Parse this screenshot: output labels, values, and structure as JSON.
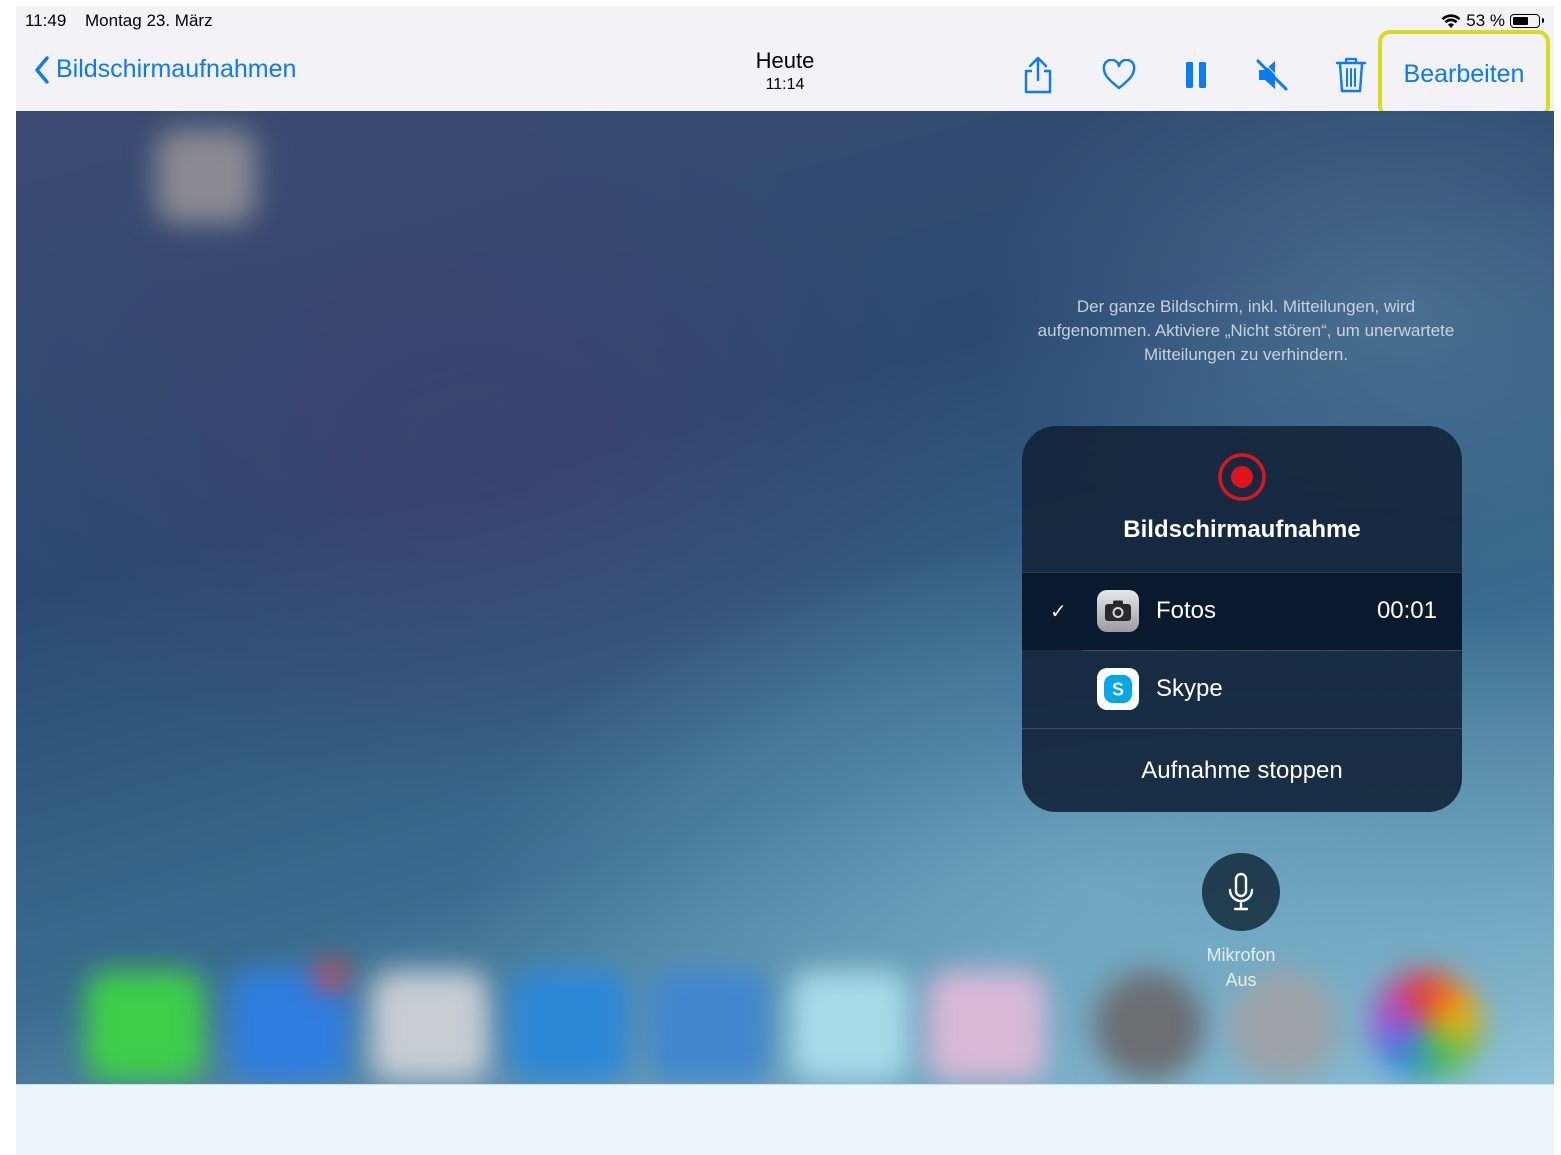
{
  "status_bar": {
    "time": "11:49",
    "date": "Montag 23. März",
    "battery_text": "53 %",
    "battery_level": 0.53
  },
  "nav": {
    "back_label": "Bildschirmaufnahmen",
    "title": "Heute",
    "subtitle": "11:14",
    "edit_label": "Bearbeiten",
    "toolbar_icons": [
      "share-icon",
      "heart-icon",
      "pause-icon",
      "mute-icon",
      "trash-icon"
    ],
    "accent_color": "#0a7aff"
  },
  "recording_panel": {
    "hint": "Der ganze Bildschirm, inkl. Mitteilungen, wird aufgenommen. Aktiviere „Nicht stören“, um unerwartete Mitteilungen zu verhindern.",
    "title": "Bildschirmaufnahme",
    "destinations": [
      {
        "label": "Fotos",
        "time": "00:01",
        "selected": true
      },
      {
        "label": "Skype",
        "time": "",
        "selected": false
      }
    ],
    "stop_label": "Aufnahme stoppen",
    "record_color": "#e0141c"
  },
  "microphone": {
    "label": "Mikrofon",
    "state": "Aus"
  },
  "highlight_color": "#d8dd1e"
}
